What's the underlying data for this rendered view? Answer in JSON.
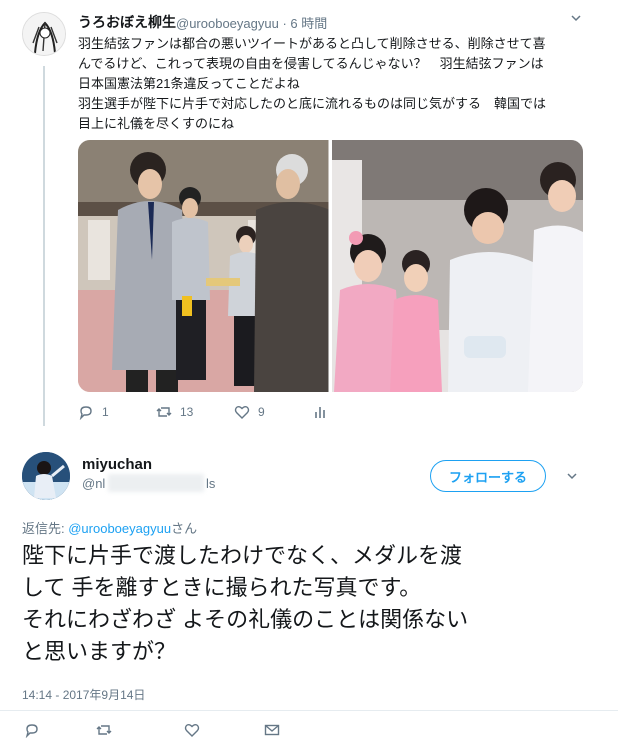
{
  "tweet1": {
    "name": "うろおぼえ柳生",
    "handle": "@urooboeyagyuu",
    "time": "· 6 時間",
    "lines": [
      "羽生結弦ファンは都合の悪いツイートがあると凸して削除させる、削除させて喜",
      "んでるけど、これって表現の自由を侵害してるんじゃない？　羽生結弦ファンは",
      "日本国憲法第21条違反ってことだよね",
      "羽生選手が陛下に片手で対応したのと底に流れるものは同じ気がする　韓国では",
      "目上に礼儀を尽くすのにね"
    ],
    "replies": "1",
    "retweets": "13",
    "likes": "9"
  },
  "tweet2": {
    "name": "miyuchan",
    "handle_start": "@nl",
    "handle_end": "ls",
    "follow_label": "フォローする",
    "reply_prefix": "返信先: ",
    "reply_handle": "@urooboeyagyuu",
    "reply_suffix": "さん",
    "lines": [
      "陛下に片手で渡したわけでなく、メダルを渡",
      "して 手を離すときに撮られた写真です。",
      "それにわざわざ よその礼儀のことは関係ない",
      "と思いますが？"
    ],
    "timestamp": "14:14 - 2017年9月14日"
  },
  "icons": {
    "reply": "reply-icon",
    "retweet": "retweet-icon",
    "like": "heart-icon",
    "analytics": "analytics-icon",
    "dm": "envelope-icon",
    "caret": "chevron-down-icon"
  },
  "colors": {
    "accent": "#1da1f2",
    "muted": "#657786"
  }
}
